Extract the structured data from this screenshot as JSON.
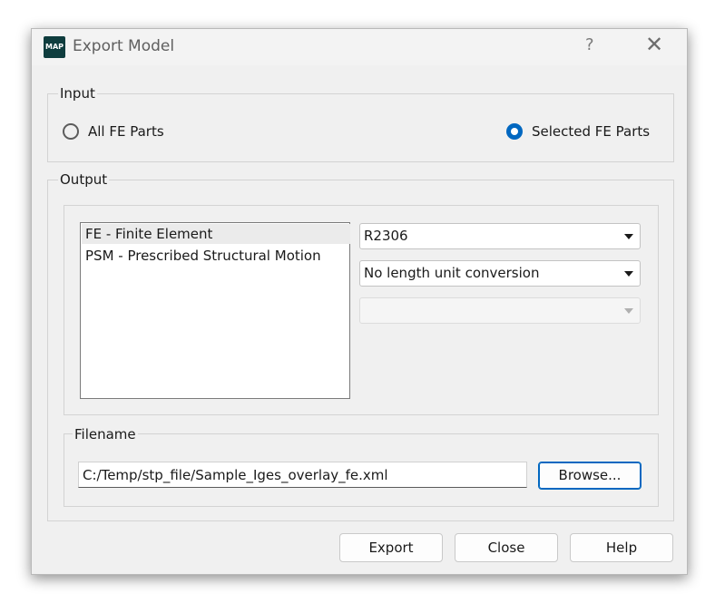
{
  "window": {
    "title": "Export Model",
    "app_icon_text": "MAP",
    "help_glyph": "?",
    "close_glyph": "✕"
  },
  "input_group": {
    "label": "Input",
    "options": [
      {
        "label": "All FE Parts",
        "selected": false
      },
      {
        "label": "Selected FE Parts",
        "selected": true
      }
    ]
  },
  "output_group": {
    "label": "Output",
    "list_items": [
      {
        "label": "FE - Finite Element",
        "selected": true
      },
      {
        "label": "PSM - Prescribed Structural Motion",
        "selected": false
      }
    ],
    "version_combo": {
      "value": "R2306"
    },
    "unit_combo": {
      "value": "No length unit conversion"
    },
    "third_combo": {
      "value": "",
      "disabled": true
    }
  },
  "filename_group": {
    "label": "Filename",
    "path_value": "C:/Temp/stp_file/Sample_Iges_overlay_fe.xml",
    "browse_label": "Browse..."
  },
  "footer": {
    "export_label": "Export",
    "close_label": "Close",
    "help_label": "Help"
  },
  "colors": {
    "accent": "#0067c0",
    "dialog_bg": "#f0f0f0",
    "app_icon_bg": "#0f3d3e"
  }
}
